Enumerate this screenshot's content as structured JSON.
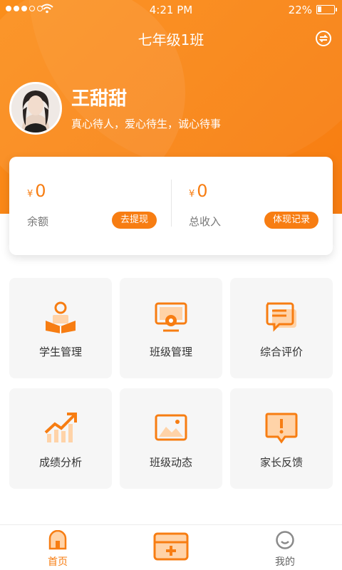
{
  "status_bar": {
    "time": "4:21 PM",
    "battery_percent": "22%",
    "battery_level": 0.22
  },
  "header": {
    "title": "七年级1班",
    "switch_icon": "switch-class-icon"
  },
  "user": {
    "name": "王甜甜",
    "motto": "真心待人，爱心待生，诚心待事"
  },
  "wallet": {
    "currency": "¥",
    "balance": {
      "amount": "0",
      "label": "余额",
      "action": "去提现"
    },
    "income": {
      "amount": "0",
      "label": "总收入",
      "action": "体现记录"
    }
  },
  "menu": [
    {
      "label": "学生管理",
      "icon": "student-reading-icon"
    },
    {
      "label": "班级管理",
      "icon": "class-monitor-icon"
    },
    {
      "label": "综合评价",
      "icon": "comment-icon"
    },
    {
      "label": "成绩分析",
      "icon": "growth-chart-icon"
    },
    {
      "label": "班级动态",
      "icon": "image-icon"
    },
    {
      "label": "家长反馈",
      "icon": "feedback-icon"
    }
  ],
  "tabbar": {
    "home": {
      "label": "首页",
      "icon": "home-icon"
    },
    "center": {
      "icon": "add-icon"
    },
    "mine": {
      "label": "我的",
      "icon": "profile-icon"
    }
  },
  "colors": {
    "accent": "#f77d12",
    "tile_bg": "#f6f6f6"
  }
}
